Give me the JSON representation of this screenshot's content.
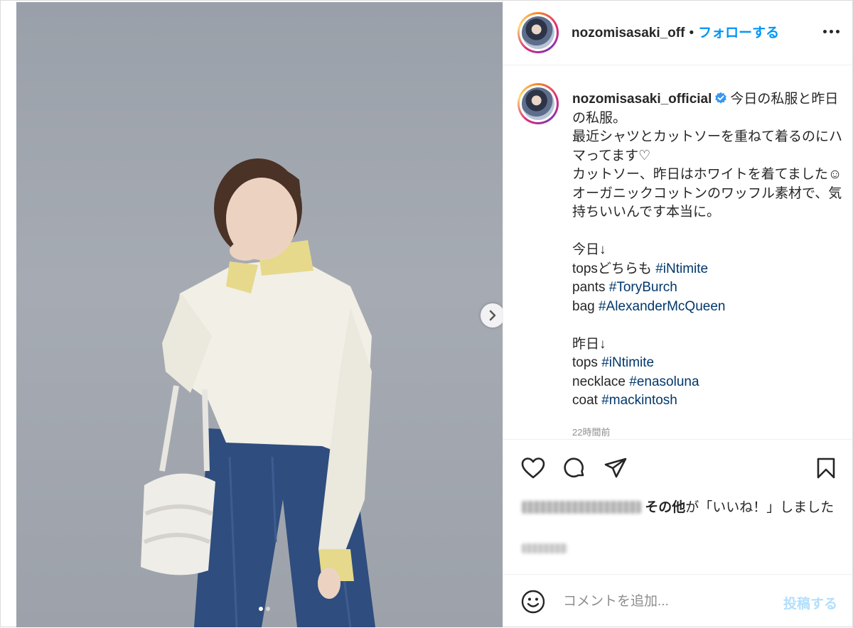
{
  "header": {
    "handle": "nozomisaski_off",
    "handle_full_shown": "nozomisasaki_off",
    "separator": "•",
    "follow_label": "フォローする"
  },
  "caption": {
    "handle": "nozomisasaki_official",
    "lines_before_tags": "今日の私服と昨日の私服。\n最近シャツとカットソーを重ねて着るのにハマってます♡\nカットソー、昨日はホワイトを着てました☺オーガニックコットンのワッフル素材で、気持ちいいんです本当に。",
    "today_heading": "今日↓",
    "today_items": [
      {
        "prefix": "topsどちらも ",
        "tag": "#iNtimite"
      },
      {
        "prefix": "pants ",
        "tag": "#ToryBurch"
      },
      {
        "prefix": "bag ",
        "tag": "#AlexanderMcQueen"
      }
    ],
    "yesterday_heading": "昨日↓",
    "yesterday_items": [
      {
        "prefix": "tops ",
        "tag": "#iNtimite"
      },
      {
        "prefix": "necklace ",
        "tag": "#enasoluna"
      },
      {
        "prefix": "coat ",
        "tag": "#mackintosh"
      }
    ],
    "time_ago": "22時間前"
  },
  "likes": {
    "others_label": "その他",
    "suffix": "が「いいね！」しました"
  },
  "comment": {
    "placeholder": "コメントを追加...",
    "post_label": "投稿する"
  },
  "icons": {
    "like": "heart-icon",
    "comment": "comment-icon",
    "share": "paper-plane-icon",
    "save": "bookmark-icon",
    "emoji": "smiley-icon",
    "more": "more-options-icon",
    "next": "chevron-right-icon",
    "verified": "verified-badge-icon"
  },
  "colors": {
    "accent": "#0095f6",
    "hashtag": "#00376b",
    "verified": "#3897f0",
    "post_disabled": "#b2dffc"
  }
}
